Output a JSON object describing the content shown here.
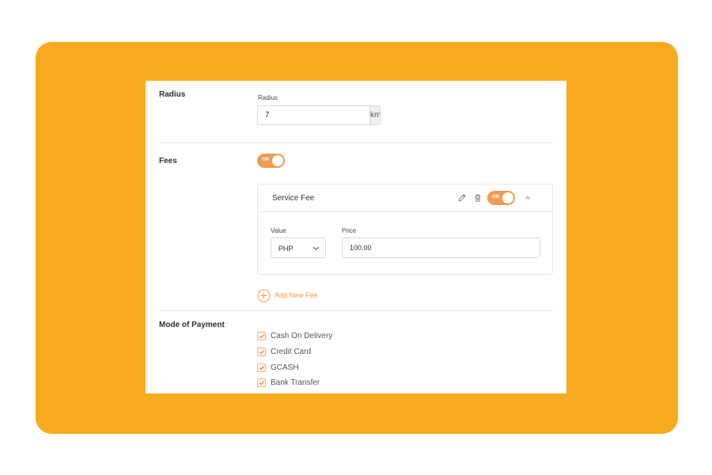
{
  "radius": {
    "section_label": "Radius",
    "field_label": "Radius",
    "value": "7",
    "unit": "km"
  },
  "fees": {
    "section_label": "Fees",
    "toggle_label": "ON",
    "card": {
      "title": "Service Fee",
      "toggle_label": "ON",
      "value_label": "Value",
      "currency": "PHP",
      "price_label": "Price",
      "price": "100.00"
    },
    "add_label": "Add New Fee"
  },
  "payment": {
    "section_label": "Mode of Payment",
    "options": [
      {
        "label": "Cash On Delivery",
        "checked": true
      },
      {
        "label": "Credit Card",
        "checked": true
      },
      {
        "label": "GCASH",
        "checked": true
      },
      {
        "label": "Bank Transfer",
        "checked": true
      }
    ]
  },
  "colors": {
    "backdrop": "#f6ab1e",
    "accent": "#f39a53",
    "panel": "#ffffff"
  }
}
